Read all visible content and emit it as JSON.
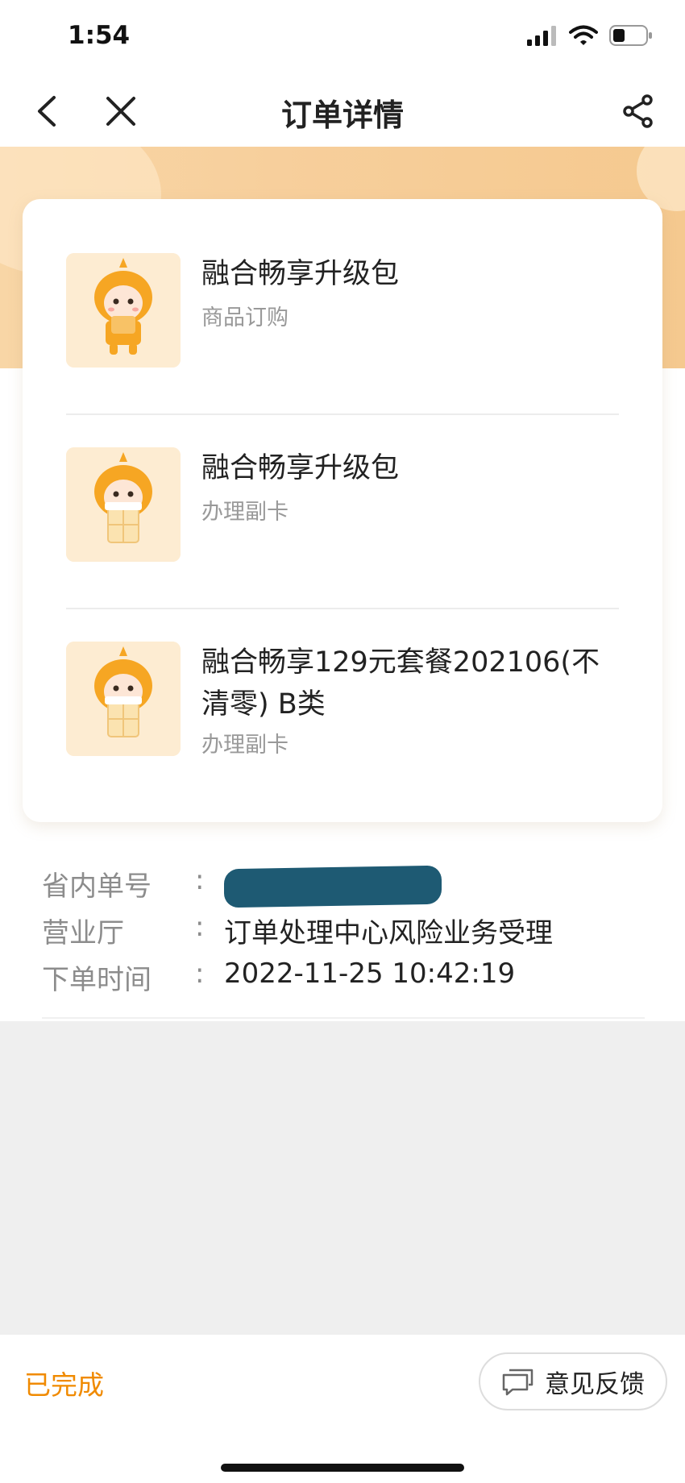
{
  "status_bar": {
    "time": "1:54"
  },
  "nav": {
    "title": "订单详情"
  },
  "items": [
    {
      "name": "融合畅享升级包",
      "type": "商品订购"
    },
    {
      "name": "融合畅享升级包",
      "type": "办理副卡"
    },
    {
      "name": "融合畅享129元套餐202106(不清零) B类",
      "type": "办理副卡"
    }
  ],
  "info": {
    "order_no_label": "省内单号",
    "hall_label": "营业厅",
    "hall_value": "订单处理中心风险业务受理",
    "time_label": "下单时间",
    "time_value": "2022-11-25 10:42:19",
    "colon": ":"
  },
  "footer": {
    "status": "已完成",
    "feedback_label": "意见反馈"
  },
  "colors": {
    "accent": "#f08a00",
    "hero": "#f7cf9c"
  }
}
